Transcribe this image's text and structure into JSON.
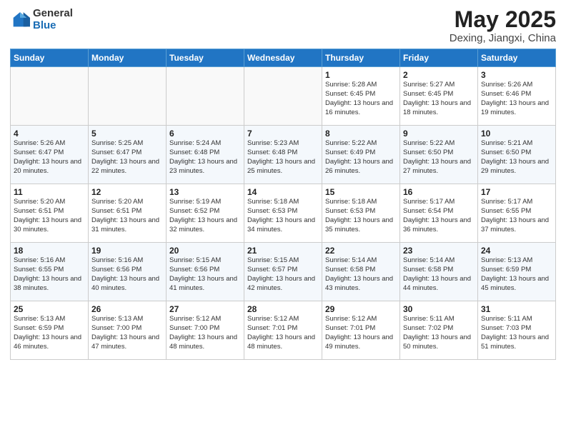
{
  "header": {
    "logo_general": "General",
    "logo_blue": "Blue",
    "month_title": "May 2025",
    "location": "Dexing, Jiangxi, China"
  },
  "weekdays": [
    "Sunday",
    "Monday",
    "Tuesday",
    "Wednesday",
    "Thursday",
    "Friday",
    "Saturday"
  ],
  "weeks": [
    [
      {
        "day": "",
        "sunrise": "",
        "sunset": "",
        "daylight": ""
      },
      {
        "day": "",
        "sunrise": "",
        "sunset": "",
        "daylight": ""
      },
      {
        "day": "",
        "sunrise": "",
        "sunset": "",
        "daylight": ""
      },
      {
        "day": "",
        "sunrise": "",
        "sunset": "",
        "daylight": ""
      },
      {
        "day": "1",
        "sunrise": "5:28 AM",
        "sunset": "6:45 PM",
        "daylight": "13 hours and 16 minutes."
      },
      {
        "day": "2",
        "sunrise": "5:27 AM",
        "sunset": "6:45 PM",
        "daylight": "13 hours and 18 minutes."
      },
      {
        "day": "3",
        "sunrise": "5:26 AM",
        "sunset": "6:46 PM",
        "daylight": "13 hours and 19 minutes."
      }
    ],
    [
      {
        "day": "4",
        "sunrise": "5:26 AM",
        "sunset": "6:47 PM",
        "daylight": "13 hours and 20 minutes."
      },
      {
        "day": "5",
        "sunrise": "5:25 AM",
        "sunset": "6:47 PM",
        "daylight": "13 hours and 22 minutes."
      },
      {
        "day": "6",
        "sunrise": "5:24 AM",
        "sunset": "6:48 PM",
        "daylight": "13 hours and 23 minutes."
      },
      {
        "day": "7",
        "sunrise": "5:23 AM",
        "sunset": "6:48 PM",
        "daylight": "13 hours and 25 minutes."
      },
      {
        "day": "8",
        "sunrise": "5:22 AM",
        "sunset": "6:49 PM",
        "daylight": "13 hours and 26 minutes."
      },
      {
        "day": "9",
        "sunrise": "5:22 AM",
        "sunset": "6:50 PM",
        "daylight": "13 hours and 27 minutes."
      },
      {
        "day": "10",
        "sunrise": "5:21 AM",
        "sunset": "6:50 PM",
        "daylight": "13 hours and 29 minutes."
      }
    ],
    [
      {
        "day": "11",
        "sunrise": "5:20 AM",
        "sunset": "6:51 PM",
        "daylight": "13 hours and 30 minutes."
      },
      {
        "day": "12",
        "sunrise": "5:20 AM",
        "sunset": "6:51 PM",
        "daylight": "13 hours and 31 minutes."
      },
      {
        "day": "13",
        "sunrise": "5:19 AM",
        "sunset": "6:52 PM",
        "daylight": "13 hours and 32 minutes."
      },
      {
        "day": "14",
        "sunrise": "5:18 AM",
        "sunset": "6:53 PM",
        "daylight": "13 hours and 34 minutes."
      },
      {
        "day": "15",
        "sunrise": "5:18 AM",
        "sunset": "6:53 PM",
        "daylight": "13 hours and 35 minutes."
      },
      {
        "day": "16",
        "sunrise": "5:17 AM",
        "sunset": "6:54 PM",
        "daylight": "13 hours and 36 minutes."
      },
      {
        "day": "17",
        "sunrise": "5:17 AM",
        "sunset": "6:55 PM",
        "daylight": "13 hours and 37 minutes."
      }
    ],
    [
      {
        "day": "18",
        "sunrise": "5:16 AM",
        "sunset": "6:55 PM",
        "daylight": "13 hours and 38 minutes."
      },
      {
        "day": "19",
        "sunrise": "5:16 AM",
        "sunset": "6:56 PM",
        "daylight": "13 hours and 40 minutes."
      },
      {
        "day": "20",
        "sunrise": "5:15 AM",
        "sunset": "6:56 PM",
        "daylight": "13 hours and 41 minutes."
      },
      {
        "day": "21",
        "sunrise": "5:15 AM",
        "sunset": "6:57 PM",
        "daylight": "13 hours and 42 minutes."
      },
      {
        "day": "22",
        "sunrise": "5:14 AM",
        "sunset": "6:58 PM",
        "daylight": "13 hours and 43 minutes."
      },
      {
        "day": "23",
        "sunrise": "5:14 AM",
        "sunset": "6:58 PM",
        "daylight": "13 hours and 44 minutes."
      },
      {
        "day": "24",
        "sunrise": "5:13 AM",
        "sunset": "6:59 PM",
        "daylight": "13 hours and 45 minutes."
      }
    ],
    [
      {
        "day": "25",
        "sunrise": "5:13 AM",
        "sunset": "6:59 PM",
        "daylight": "13 hours and 46 minutes."
      },
      {
        "day": "26",
        "sunrise": "5:13 AM",
        "sunset": "7:00 PM",
        "daylight": "13 hours and 47 minutes."
      },
      {
        "day": "27",
        "sunrise": "5:12 AM",
        "sunset": "7:00 PM",
        "daylight": "13 hours and 48 minutes."
      },
      {
        "day": "28",
        "sunrise": "5:12 AM",
        "sunset": "7:01 PM",
        "daylight": "13 hours and 48 minutes."
      },
      {
        "day": "29",
        "sunrise": "5:12 AM",
        "sunset": "7:01 PM",
        "daylight": "13 hours and 49 minutes."
      },
      {
        "day": "30",
        "sunrise": "5:11 AM",
        "sunset": "7:02 PM",
        "daylight": "13 hours and 50 minutes."
      },
      {
        "day": "31",
        "sunrise": "5:11 AM",
        "sunset": "7:03 PM",
        "daylight": "13 hours and 51 minutes."
      }
    ]
  ]
}
